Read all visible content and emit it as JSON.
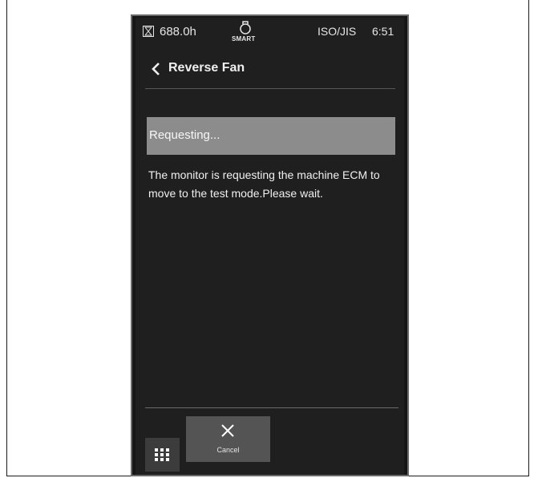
{
  "status_bar": {
    "hours": "688.0h",
    "smart_label": "SMART",
    "standard": "ISO/JIS",
    "time": "6:51"
  },
  "header": {
    "title": "Reverse Fan"
  },
  "content": {
    "status_text": "Requesting...",
    "message": "The monitor is requesting the machine ECM to move to the test mode.Please wait."
  },
  "footer": {
    "cancel_label": "Cancel"
  },
  "icons": {
    "hourglass": "hourglass-icon",
    "engine": "smart-engine-icon",
    "back": "chevron-left-icon",
    "menu": "grid-icon",
    "cancel": "close-icon"
  },
  "colors": {
    "screen_background": "#1f1f1f",
    "status_bar_background": "#8c8c8c",
    "cancel_button_background": "#545454",
    "menu_button_background": "#3c3c3c"
  }
}
